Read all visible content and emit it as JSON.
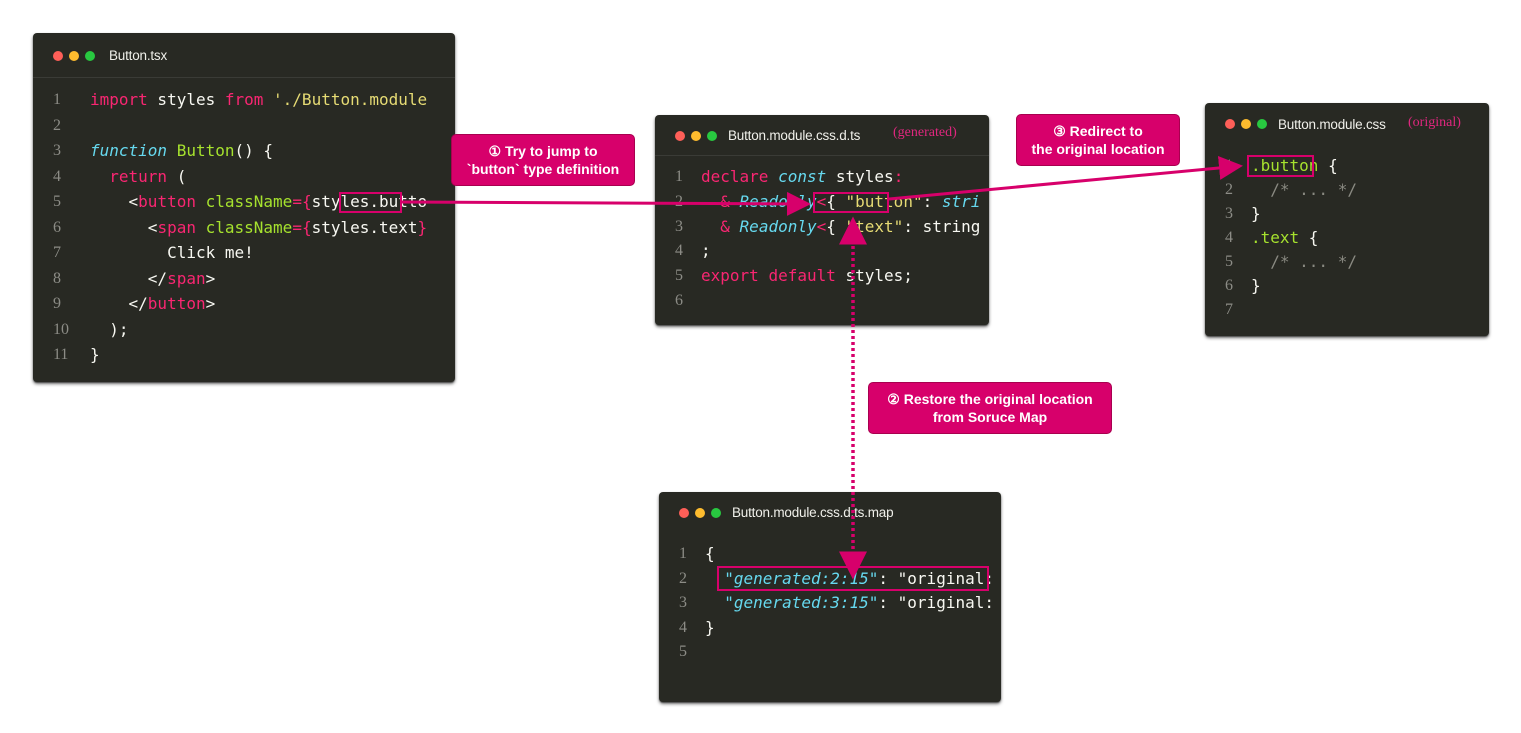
{
  "colors": {
    "accent": "#d7006b",
    "window_bg": "#282923",
    "keyword": "#f92672",
    "type_italic": "#66d9ef",
    "function": "#a6e22e",
    "string": "#e6db74",
    "comment": "#8a8a82",
    "plain": "#f8f8f2"
  },
  "windows": {
    "tsx": {
      "filename": "Button.tsx",
      "lines": [
        {
          "n": "1",
          "t": [
            [
              "kw",
              "import"
            ],
            [
              "pl",
              " styles "
            ],
            [
              "kw",
              "from"
            ],
            [
              "pl",
              " "
            ],
            [
              "str",
              "'./Button.module"
            ]
          ]
        },
        {
          "n": "2",
          "t": []
        },
        {
          "n": "3",
          "t": [
            [
              "it",
              "function"
            ],
            [
              "pl",
              " "
            ],
            [
              "fn",
              "Button"
            ],
            [
              "pl",
              "() {"
            ]
          ]
        },
        {
          "n": "4",
          "t": [
            [
              "pl",
              "  "
            ],
            [
              "kw",
              "return"
            ],
            [
              "pl",
              " ("
            ]
          ]
        },
        {
          "n": "5",
          "t": [
            [
              "pl",
              "    <"
            ],
            [
              "kw",
              "button"
            ],
            [
              "pl",
              " "
            ],
            [
              "fn",
              "className"
            ],
            [
              "kw",
              "={"
            ],
            [
              "pl",
              "styles.butto"
            ]
          ]
        },
        {
          "n": "6",
          "t": [
            [
              "pl",
              "      <"
            ],
            [
              "kw",
              "span"
            ],
            [
              "pl",
              " "
            ],
            [
              "fn",
              "className"
            ],
            [
              "kw",
              "={"
            ],
            [
              "pl",
              "styles.text"
            ],
            [
              "kw",
              "}"
            ]
          ]
        },
        {
          "n": "7",
          "t": [
            [
              "pl",
              "        Click me!"
            ]
          ]
        },
        {
          "n": "8",
          "t": [
            [
              "pl",
              "      </"
            ],
            [
              "kw",
              "span"
            ],
            [
              "pl",
              ">"
            ]
          ]
        },
        {
          "n": "9",
          "t": [
            [
              "pl",
              "    </"
            ],
            [
              "kw",
              "button"
            ],
            [
              "pl",
              ">"
            ]
          ]
        },
        {
          "n": "10",
          "t": [
            [
              "pl",
              "  );"
            ]
          ]
        },
        {
          "n": "11",
          "t": [
            [
              "pl",
              "}"
            ]
          ]
        }
      ]
    },
    "dts": {
      "filename": "Button.module.css.d.ts",
      "tag": "(generated)",
      "lines": [
        {
          "n": "1",
          "t": [
            [
              "kw",
              "declare"
            ],
            [
              "pl",
              " "
            ],
            [
              "it",
              "const"
            ],
            [
              "pl",
              " styles"
            ],
            [
              "kw",
              ":"
            ]
          ]
        },
        {
          "n": "2",
          "t": [
            [
              "pl",
              "  "
            ],
            [
              "kw",
              "&"
            ],
            [
              "pl",
              " "
            ],
            [
              "it",
              "Readonly"
            ],
            [
              "kw",
              "<"
            ],
            [
              "pl",
              "{ "
            ],
            [
              "str",
              "\"button\""
            ],
            [
              "pl",
              ": "
            ],
            [
              "it",
              "stri"
            ]
          ]
        },
        {
          "n": "3",
          "t": [
            [
              "pl",
              "  "
            ],
            [
              "kw",
              "&"
            ],
            [
              "pl",
              " "
            ],
            [
              "it",
              "Readonly"
            ],
            [
              "kw",
              "<"
            ],
            [
              "pl",
              "{ "
            ],
            [
              "str",
              "\"text\""
            ],
            [
              "pl",
              ": string"
            ]
          ]
        },
        {
          "n": "4",
          "t": [
            [
              "pl",
              ";"
            ]
          ]
        },
        {
          "n": "5",
          "t": [
            [
              "kw",
              "export"
            ],
            [
              "pl",
              " "
            ],
            [
              "kw",
              "default"
            ],
            [
              "pl",
              " styles;"
            ]
          ]
        },
        {
          "n": "6",
          "t": []
        }
      ]
    },
    "css": {
      "filename": "Button.module.css",
      "tag": "(original)",
      "lines": [
        {
          "n": "1",
          "t": [
            [
              "fn",
              ".button"
            ],
            [
              "pl",
              " {"
            ]
          ]
        },
        {
          "n": "2",
          "t": [
            [
              "cm",
              "  /* ... */"
            ]
          ]
        },
        {
          "n": "3",
          "t": [
            [
              "pl",
              "}"
            ]
          ]
        },
        {
          "n": "4",
          "t": [
            [
              "fn",
              ".text"
            ],
            [
              "pl",
              " {"
            ]
          ]
        },
        {
          "n": "5",
          "t": [
            [
              "cm",
              "  /* ... */"
            ]
          ]
        },
        {
          "n": "6",
          "t": [
            [
              "pl",
              "}"
            ]
          ]
        },
        {
          "n": "7",
          "t": []
        }
      ]
    },
    "map": {
      "filename": "Button.module.css.d.ts.map",
      "lines": [
        {
          "n": "1",
          "t": [
            [
              "pl",
              "{"
            ]
          ]
        },
        {
          "n": "2",
          "t": [
            [
              "pl",
              "  "
            ],
            [
              "it",
              "\"generated:2:15\""
            ],
            [
              "pl",
              ": \"original:"
            ]
          ]
        },
        {
          "n": "3",
          "t": [
            [
              "pl",
              "  "
            ],
            [
              "it",
              "\"generated:3:15\""
            ],
            [
              "pl",
              ": \"original:"
            ]
          ]
        },
        {
          "n": "4",
          "t": [
            [
              "pl",
              "}"
            ]
          ]
        },
        {
          "n": "5",
          "t": []
        }
      ]
    }
  },
  "callouts": {
    "step1": {
      "line1": "① Try to jump to",
      "line2": "`button` type definition"
    },
    "step2": {
      "line1": "② Restore the original location",
      "line2": "from Soruce Map"
    },
    "step3": {
      "line1": "③ Redirect to",
      "line2": "the original location"
    }
  }
}
